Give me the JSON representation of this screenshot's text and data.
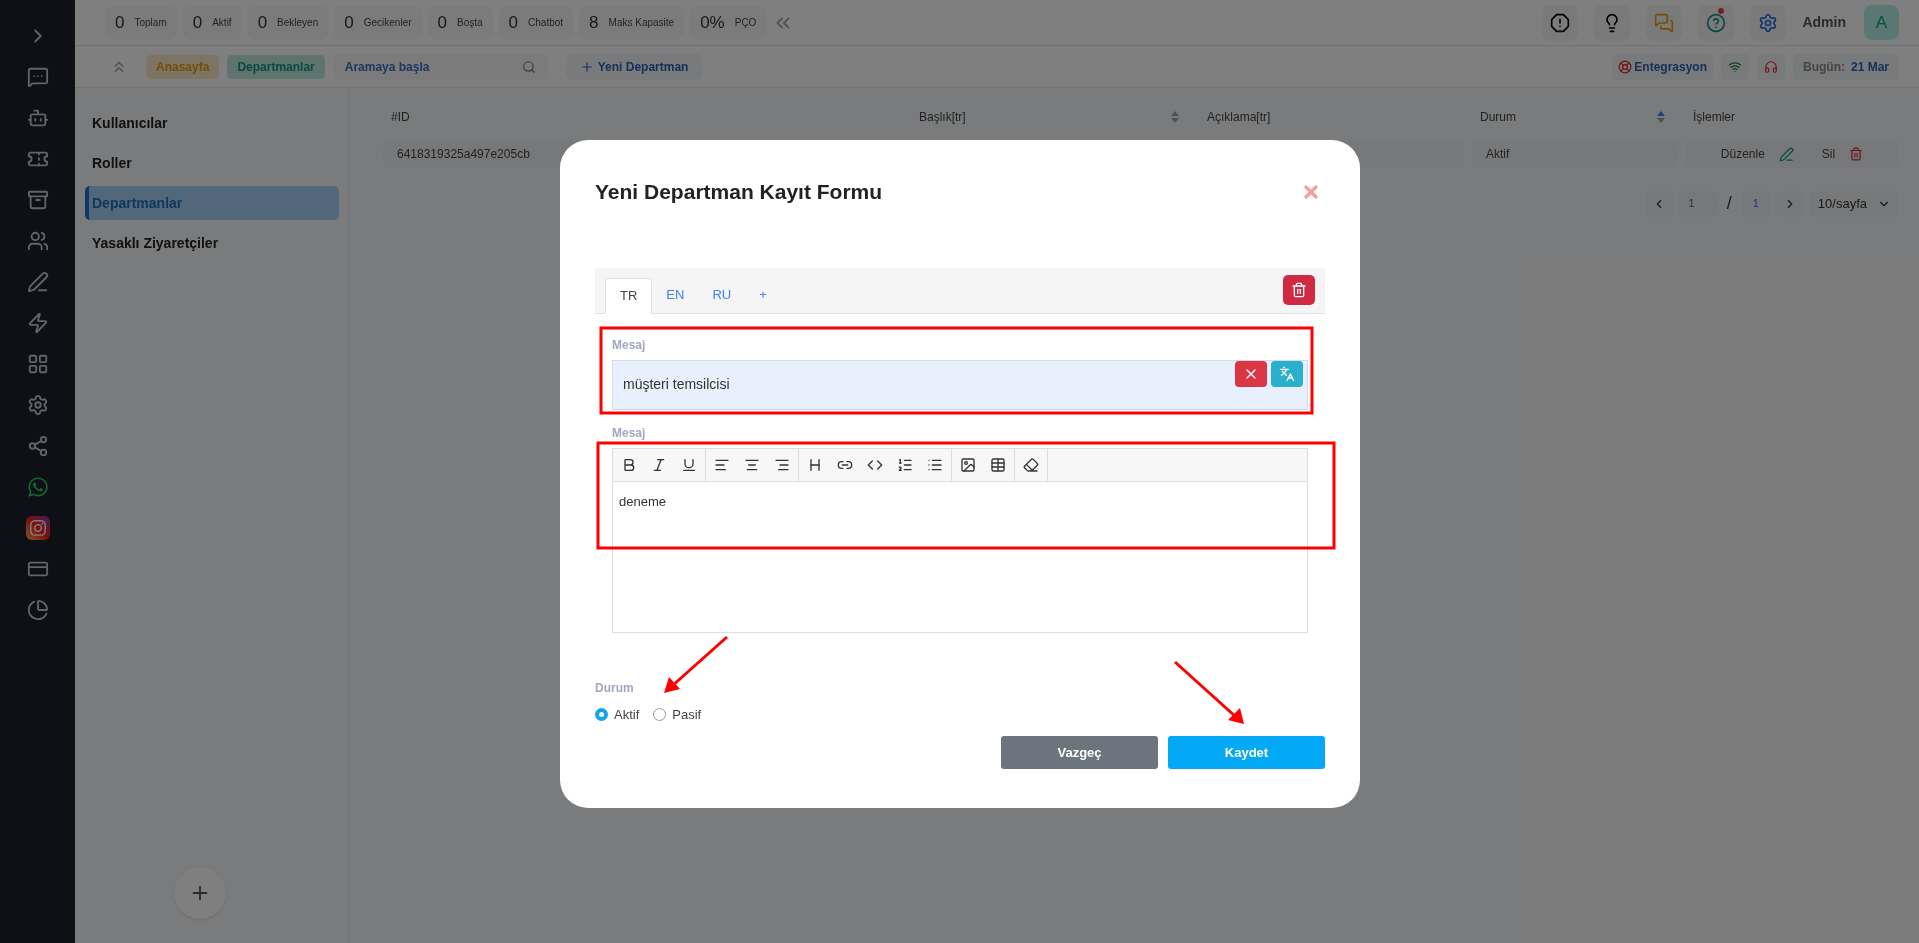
{
  "stats": [
    {
      "value": "0",
      "label": "Toplam"
    },
    {
      "value": "0",
      "label": "Aktif"
    },
    {
      "value": "0",
      "label": "Bekleyen"
    },
    {
      "value": "0",
      "label": "Gecikenler"
    },
    {
      "value": "0",
      "label": "Boşta"
    },
    {
      "value": "0",
      "label": "Chatbot"
    },
    {
      "value": "8",
      "label": "Maks Kapasite"
    },
    {
      "value": "0%",
      "label": "PÇO"
    }
  ],
  "header": {
    "user": "Admin",
    "avatar": "A"
  },
  "breadcrumbs": [
    {
      "label": "Anasayfa",
      "kind": "home"
    },
    {
      "label": "Departmanlar",
      "kind": "current"
    }
  ],
  "search": {
    "placeholder": "Aramaya başla"
  },
  "new_button": "Yeni Departman",
  "status_bar": {
    "integration": "Entegrasyon",
    "today_label": "Bugün:",
    "today": "21 Mar"
  },
  "submenu": [
    {
      "label": "Kullanıcılar",
      "selected": false
    },
    {
      "label": "Roller",
      "selected": false
    },
    {
      "label": "Departmanlar",
      "selected": true
    },
    {
      "label": "Yasaklı Ziyaretçiler",
      "selected": false
    }
  ],
  "table": {
    "columns": [
      {
        "label": "#ID"
      },
      {
        "label": "Başlık[tr]",
        "sortable": true,
        "sorted": false
      },
      {
        "label": "Açıklama[tr]"
      },
      {
        "label": "Durum",
        "sortable": true,
        "sorted": true
      },
      {
        "label": "İşlemler"
      }
    ],
    "rows": [
      {
        "id": "6418319325a497e205cb",
        "status": "Aktif",
        "edit": "Düzenle",
        "delete": "Sil"
      }
    ]
  },
  "pagination": {
    "page": "1",
    "separator": "/",
    "total": "1",
    "per_page": "10/sayfa"
  },
  "modal": {
    "title": "Yeni Departman Kayıt Formu",
    "tabs": [
      {
        "label": "TR",
        "selected": true
      },
      {
        "label": "EN",
        "selected": false
      },
      {
        "label": "RU",
        "selected": false
      },
      {
        "label": "+",
        "selected": false
      }
    ],
    "field": {
      "label": "Mesaj",
      "value": "müşteri temsilcisi"
    },
    "editor": {
      "label": "Mesaj",
      "content": "deneme"
    },
    "status": {
      "label": "Durum",
      "options": [
        {
          "label": "Aktif",
          "selected": true
        },
        {
          "label": "Pasif",
          "selected": false
        }
      ]
    },
    "buttons": [
      {
        "label": "Vazgeç",
        "kind": "cancel"
      },
      {
        "label": "Kaydet",
        "kind": "primary"
      }
    ]
  }
}
